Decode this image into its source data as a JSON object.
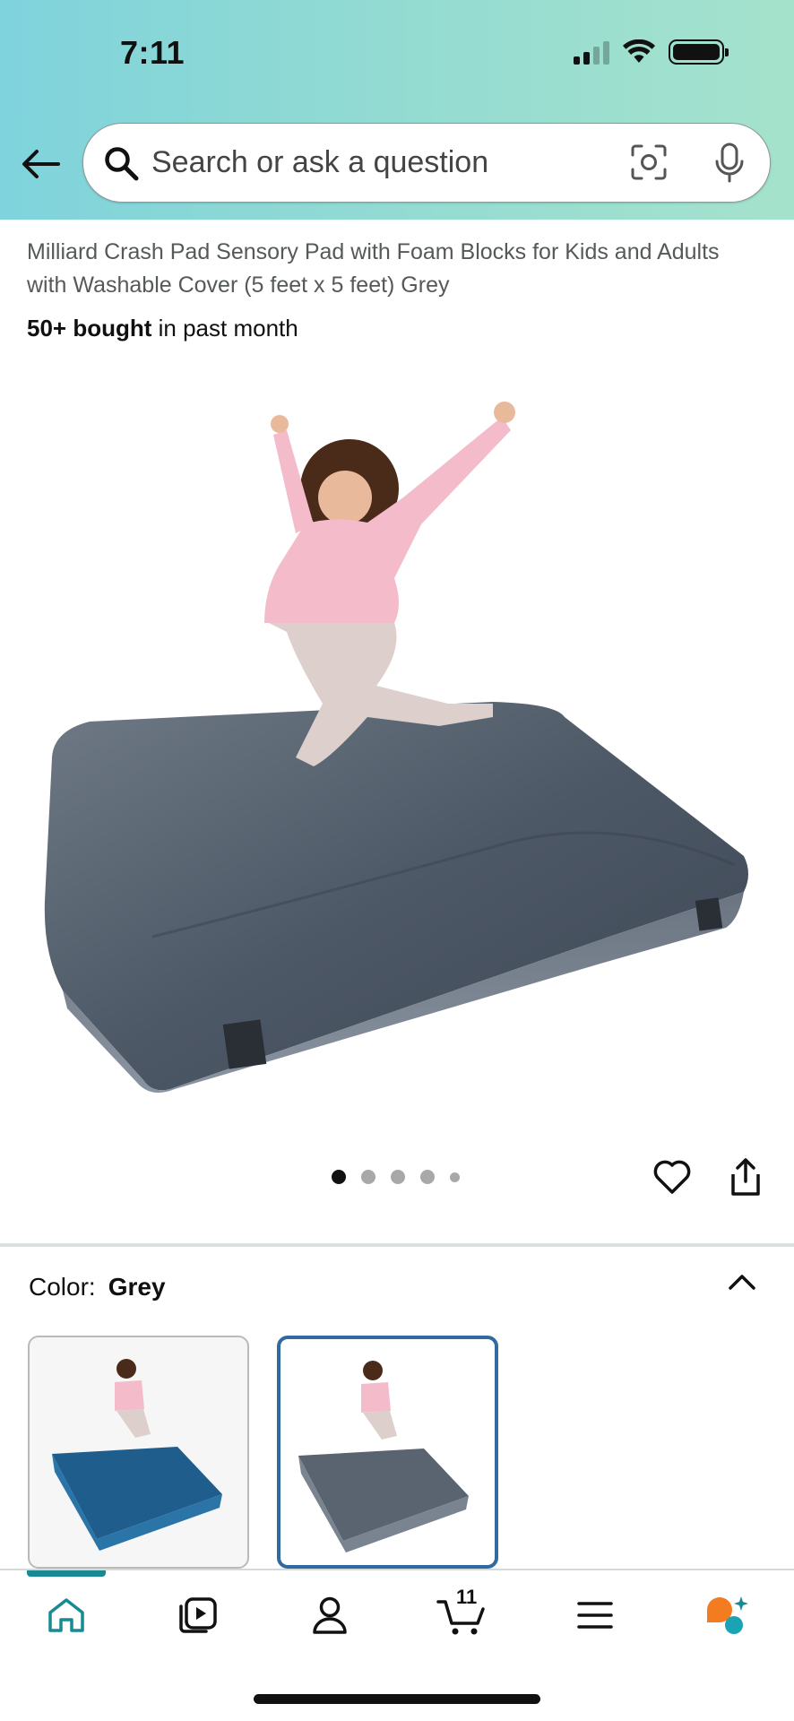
{
  "status_bar": {
    "time": "7:11"
  },
  "search": {
    "placeholder": "Search or ask a question"
  },
  "product": {
    "title": "Milliard Crash Pad Sensory Pad with Foam Blocks for Kids and Adults with Washable Cover (5 feet x 5 feet) Grey",
    "bought_bold": "50+ bought",
    "bought_rest": " in past month",
    "image_count": 5,
    "active_image_index": 0
  },
  "color_selector": {
    "label": "Color:",
    "value": "Grey",
    "options": [
      {
        "color": "#1f5e8c"
      },
      {
        "color": "#5a6470",
        "selected": true
      }
    ]
  },
  "bottom_nav": {
    "cart_count": "11",
    "items": [
      "home-icon",
      "video-icon",
      "account-icon",
      "cart-icon",
      "menu-icon",
      "rufus-icon"
    ]
  },
  "colors": {
    "header_gradient_start": "#7fd3dc",
    "header_gradient_end": "#a5e2cc",
    "accent": "#178a93",
    "selected_border": "#2f6aa0"
  }
}
